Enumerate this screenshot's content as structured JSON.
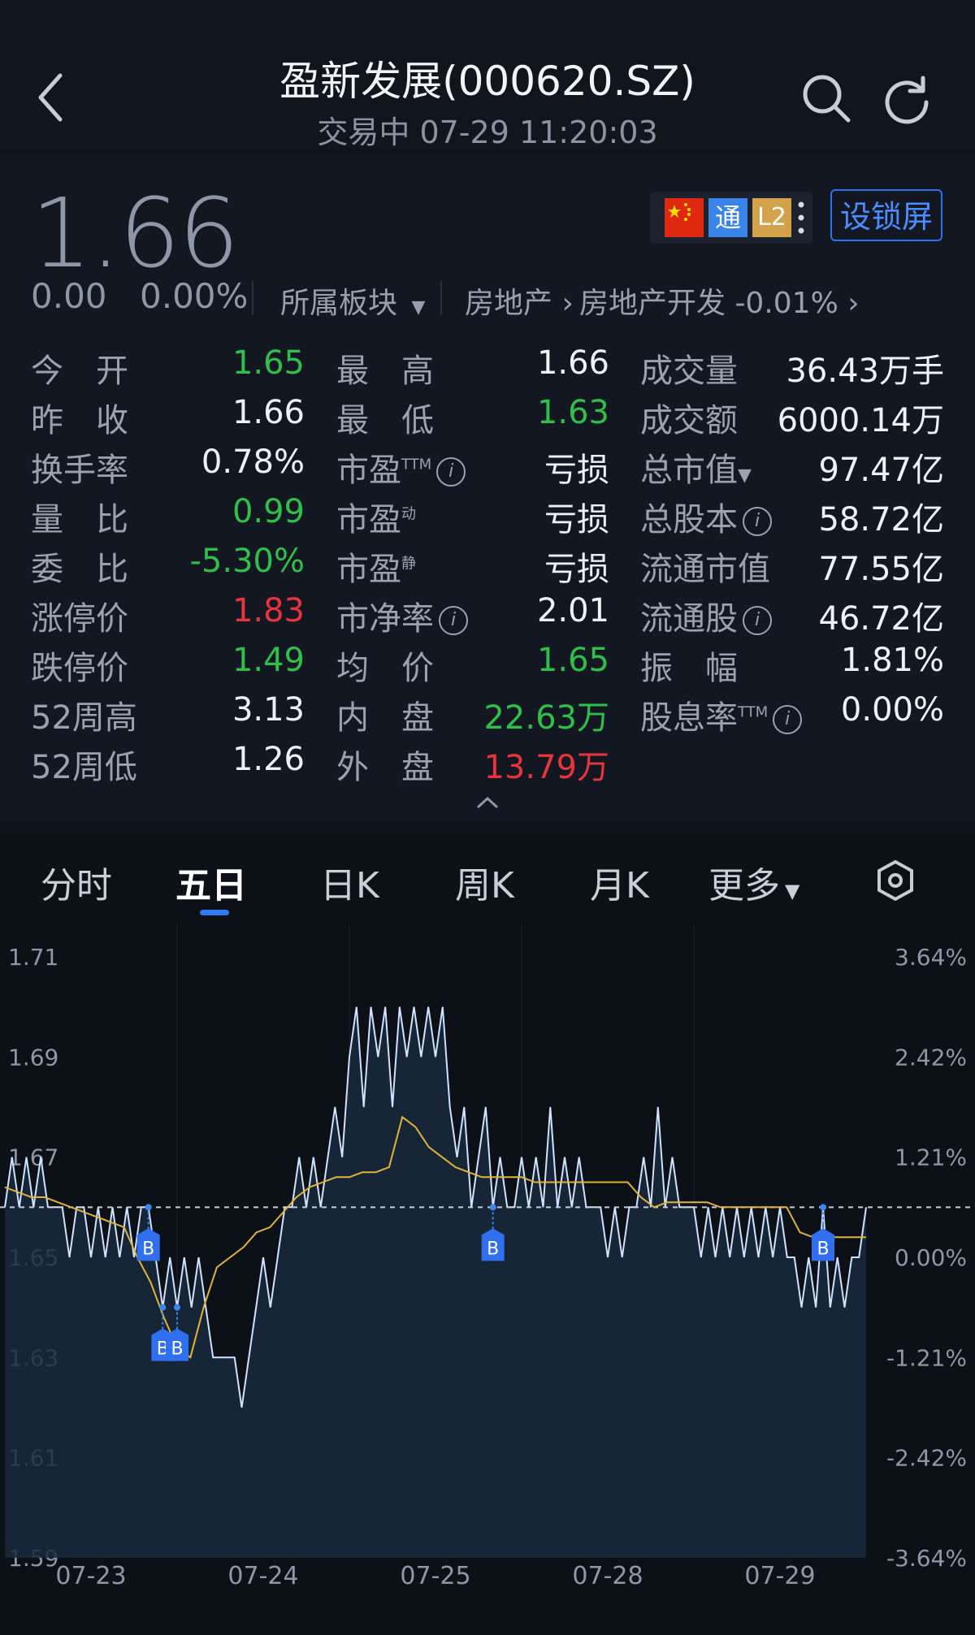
{
  "header": {
    "title": "盈新发展(000620.SZ)",
    "subtitle": "交易中 07-29 11:20:03",
    "back_icon": "back-arrow-icon",
    "search_icon": "search-icon",
    "refresh_icon": "refresh-icon"
  },
  "quote": {
    "price": "1.66",
    "change": "0.00",
    "change_pct": "0.00%",
    "sector_label": "所属板块",
    "sector_path": "房地产",
    "sector_sub": "房地产开发 -0.01%",
    "badges": {
      "flag": "china-flag-icon",
      "tong": "通",
      "l2": "L2"
    },
    "lock_button": "设锁屏",
    "colors": {
      "up": "#e8343c",
      "down": "#2fbf4a",
      "neutral": "#eef1f5",
      "accent": "#2f6ff0"
    }
  },
  "stats": {
    "col1": [
      {
        "label": "今　开",
        "value": "1.65",
        "color": "green"
      },
      {
        "label": "昨　收",
        "value": "1.66",
        "color": "neutral"
      },
      {
        "label": "换手率",
        "value": "0.78%",
        "color": "neutral"
      },
      {
        "label": "量　比",
        "value": "0.99",
        "color": "green"
      },
      {
        "label": "委　比",
        "value": "-5.30%",
        "color": "green"
      },
      {
        "label": "涨停价",
        "value": "1.83",
        "color": "red"
      },
      {
        "label": "跌停价",
        "value": "1.49",
        "color": "green"
      },
      {
        "label": "52周高",
        "value": "3.13",
        "color": "neutral"
      },
      {
        "label": "52周低",
        "value": "1.26",
        "color": "neutral"
      }
    ],
    "col2": [
      {
        "label": "最　高",
        "value": "1.66",
        "color": "neutral"
      },
      {
        "label": "最　低",
        "value": "1.63",
        "color": "green"
      },
      {
        "label": "市盈",
        "sup": "TTM",
        "info": true,
        "value": "亏损",
        "color": "neutral"
      },
      {
        "label": "市盈",
        "sup": "动",
        "value": "亏损",
        "color": "neutral"
      },
      {
        "label": "市盈",
        "sup": "静",
        "value": "亏损",
        "color": "neutral"
      },
      {
        "label": "市净率",
        "info": true,
        "value": "2.01",
        "color": "neutral"
      },
      {
        "label": "均　价",
        "value": "1.65",
        "color": "green"
      },
      {
        "label": "内　盘",
        "value": "22.63万",
        "color": "green"
      },
      {
        "label": "外　盘",
        "value": "13.79万",
        "color": "red"
      }
    ],
    "col3": [
      {
        "label": "成交量",
        "value": "36.43万手"
      },
      {
        "label": "成交额",
        "value": "6000.14万"
      },
      {
        "label": "总市值",
        "dropdown": true,
        "value": "97.47亿"
      },
      {
        "label": "总股本",
        "info": true,
        "value": "58.72亿"
      },
      {
        "label": "流通市值",
        "value": "77.55亿"
      },
      {
        "label": "流通股",
        "info": true,
        "value": "46.72亿"
      },
      {
        "label": "振　幅",
        "value": "1.81%"
      },
      {
        "label": "股息率",
        "sup": "TTM",
        "info": true,
        "value": "0.00%"
      }
    ]
  },
  "tabs": [
    {
      "label": "分时",
      "active": false
    },
    {
      "label": "五日",
      "active": true
    },
    {
      "label": "日K",
      "active": false
    },
    {
      "label": "周K",
      "active": false
    },
    {
      "label": "月K",
      "active": false
    },
    {
      "label": "更多",
      "active": false,
      "dropdown": true
    }
  ],
  "settings_icon": "settings-hex-icon",
  "chart_data": {
    "type": "line",
    "y_left_ticks": [
      "1.71",
      "1.69",
      "1.67",
      "1.65",
      "1.63",
      "1.61",
      "1.59"
    ],
    "y_right_ticks": [
      "3.64%",
      "2.42%",
      "1.21%",
      "0.00%",
      "-1.21%",
      "-2.42%",
      "-3.64%"
    ],
    "x_labels": [
      "07-23",
      "07-24",
      "07-25",
      "07-28",
      "07-29"
    ],
    "ylim": [
      1.59,
      1.71
    ],
    "prev_close": 1.66,
    "series": [
      {
        "role": "price",
        "values": [
          1.66,
          1.67,
          1.66,
          1.67,
          1.66,
          1.67,
          1.66,
          1.66,
          1.66,
          1.65,
          1.66,
          1.66,
          1.65,
          1.66,
          1.65,
          1.66,
          1.65,
          1.66,
          1.65,
          1.66,
          1.66,
          1.65,
          1.64,
          1.65,
          1.64,
          1.65,
          1.64,
          1.65,
          1.64,
          1.63,
          1.63,
          1.63,
          1.63,
          1.62,
          1.63,
          1.64,
          1.65,
          1.64,
          1.65,
          1.66,
          1.66,
          1.67,
          1.66,
          1.67,
          1.66,
          1.67,
          1.68,
          1.67,
          1.69,
          1.7,
          1.68,
          1.7,
          1.69,
          1.7,
          1.68,
          1.7,
          1.69,
          1.7,
          1.69,
          1.7,
          1.69,
          1.7,
          1.68,
          1.67,
          1.68,
          1.66,
          1.67,
          1.68,
          1.66,
          1.67,
          1.66,
          1.66,
          1.67,
          1.66,
          1.67,
          1.66,
          1.68,
          1.66,
          1.67,
          1.66,
          1.67,
          1.66,
          1.66,
          1.66,
          1.65,
          1.66,
          1.65,
          1.66,
          1.66,
          1.67,
          1.66,
          1.68,
          1.66,
          1.67,
          1.66,
          1.66,
          1.66,
          1.65,
          1.66,
          1.65,
          1.66,
          1.65,
          1.66,
          1.65,
          1.66,
          1.65,
          1.66,
          1.65,
          1.66,
          1.65,
          1.65,
          1.64,
          1.65,
          1.64,
          1.66,
          1.64,
          1.65,
          1.64,
          1.65,
          1.65,
          1.66
        ]
      },
      {
        "role": "average",
        "values": [
          1.664,
          1.663,
          1.662,
          1.662,
          1.661,
          1.66,
          1.659,
          1.658,
          1.657,
          1.656,
          1.65,
          1.645,
          1.638,
          1.632,
          1.63,
          1.64,
          1.648,
          1.65,
          1.652,
          1.655,
          1.656,
          1.659,
          1.662,
          1.664,
          1.665,
          1.666,
          1.666,
          1.667,
          1.667,
          1.668,
          1.678,
          1.676,
          1.672,
          1.67,
          1.668,
          1.667,
          1.666,
          1.666,
          1.666,
          1.666,
          1.665,
          1.665,
          1.665,
          1.665,
          1.665,
          1.665,
          1.665,
          1.665,
          1.662,
          1.66,
          1.661,
          1.661,
          1.661,
          1.661,
          1.66,
          1.66,
          1.66,
          1.66,
          1.66,
          1.66,
          1.655,
          1.654,
          1.654,
          1.654,
          1.654,
          1.654
        ]
      }
    ],
    "markers": [
      {
        "label": "B",
        "x_index": 20
      },
      {
        "label": "B",
        "x_index": 22
      },
      {
        "label": "B",
        "x_index": 24
      },
      {
        "label": "B",
        "x_index": 68
      },
      {
        "label": "B",
        "x_index": 114
      }
    ]
  }
}
